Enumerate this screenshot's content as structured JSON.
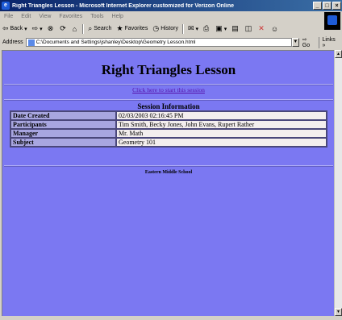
{
  "window": {
    "title": "Right Triangles Lesson - Microsoft Internet Explorer customized for Verizon Online"
  },
  "menu": [
    "File",
    "Edit",
    "View",
    "Favorites",
    "Tools",
    "Help"
  ],
  "toolbar": {
    "back": "Back",
    "search": "Search",
    "favorites": "Favorites",
    "history": "History"
  },
  "address": {
    "label": "Address",
    "url": "C:\\Documents and Settings\\jshanley\\Desktop\\Geometry Lesson.html",
    "go": "Go",
    "links": "Links"
  },
  "page": {
    "title": "Right Triangles Lesson",
    "start_link": "Click here to start this session",
    "session_heading": "Session Information",
    "rows": [
      {
        "label": "Date Created",
        "value": "02/03/2003 02:16:45 PM"
      },
      {
        "label": "Participants",
        "value": "Tim Smith, Becky Jones, John Evans, Rupert Rather"
      },
      {
        "label": "Manager",
        "value": "Mr. Math"
      },
      {
        "label": "Subject",
        "value": "Geometry 101"
      }
    ],
    "footer": "Eastern Middle School"
  },
  "colors": {
    "page_background": "#7b78f2",
    "title_bar": "#0a246a",
    "link": "#5511aa"
  }
}
